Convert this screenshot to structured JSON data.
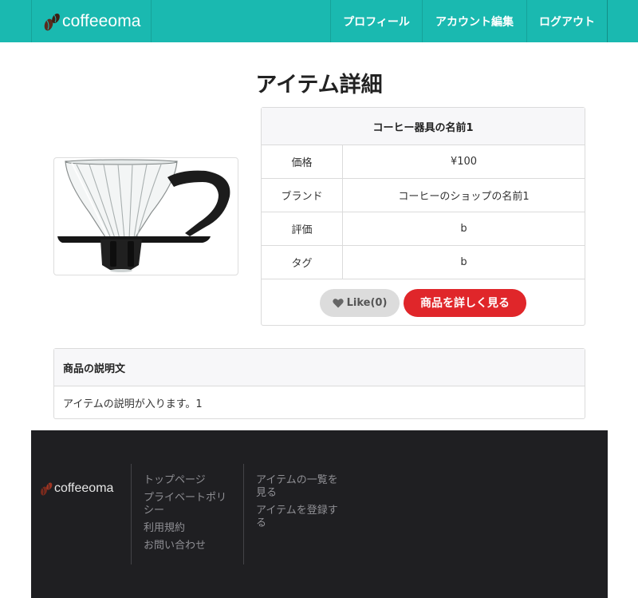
{
  "header": {
    "brand": "coffeeoma",
    "nav": [
      "プロフィール",
      "アカウント編集",
      "ログアウト"
    ]
  },
  "page_title": "アイテム詳細",
  "product": {
    "name": "コーヒー器具の名前1",
    "rows": [
      {
        "label": "価格",
        "value": "¥100"
      },
      {
        "label": "ブランド",
        "value": "コーヒーのショップの名前1"
      },
      {
        "label": "評価",
        "value": "b"
      },
      {
        "label": "タグ",
        "value": "b"
      }
    ],
    "like_label": "Like(0)",
    "view_label": "商品を詳しく見る"
  },
  "description": {
    "title": "商品の説明文",
    "text": "アイテムの説明が入ります。1"
  },
  "footer": {
    "brand": "coffeeoma",
    "col1": [
      "トップページ",
      "プライベートポリシー",
      "利用規約",
      "お問い合わせ"
    ],
    "col2": [
      "アイテムの一覧を見る",
      "アイテムを登録する"
    ]
  },
  "colors": {
    "header_bg": "#1ab9b0",
    "like_bg": "#dcdcdc",
    "primary_button": "#e0262a",
    "footer_bg": "#1f1f22"
  },
  "icons": [
    "coffee-beans-logo-icon",
    "heart-icon",
    "dripper-product-image"
  ]
}
